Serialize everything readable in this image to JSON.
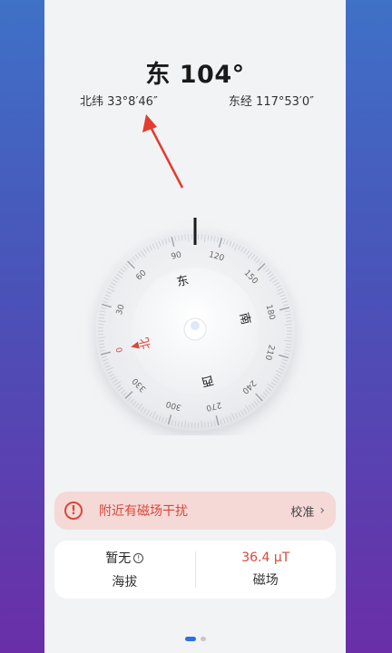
{
  "heading": {
    "direction": "东",
    "degrees": "104°"
  },
  "coords": {
    "latitude": "北纬 33°8′46″",
    "longitude": "东经 117°53′0″"
  },
  "dial": {
    "heading_deg": 104,
    "ticks": [
      "0",
      "30",
      "60",
      "90",
      "120",
      "150",
      "180",
      "210",
      "240",
      "270",
      "300",
      "330"
    ],
    "cardinals": {
      "north": "北",
      "east": "东",
      "south": "南",
      "west": "西"
    }
  },
  "alert": {
    "text": "附近有磁场干扰",
    "action": "校准"
  },
  "info": {
    "altitude_value": "暂无",
    "altitude_label": "海拔",
    "magnetic_value": "36.4 μT",
    "magnetic_label": "磁场"
  },
  "colors": {
    "accent": "#d9473a",
    "blue": "#2f6fe0"
  },
  "icons": {
    "alert": "exclamation-circle-icon",
    "chevron": "chevron-right-icon",
    "info": "info-circle-icon"
  },
  "pager": {
    "pages": 2,
    "active": 0
  }
}
